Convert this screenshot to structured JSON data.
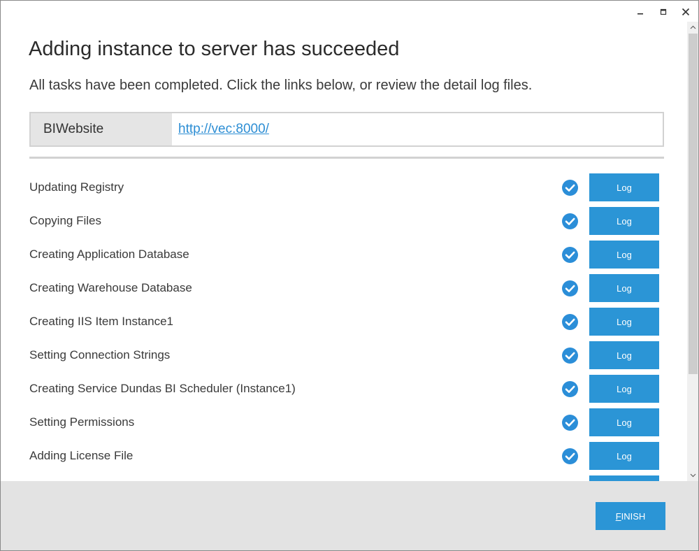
{
  "window": {
    "controls": {
      "minimize_icon": "minimize-icon",
      "maximize_icon": "maximize-icon",
      "close_icon": "close-icon"
    }
  },
  "header": {
    "title": "Adding instance to server has succeeded",
    "subtitle": "All tasks have been completed.  Click the links below, or review the detail log files."
  },
  "website": {
    "label": "BIWebsite",
    "url": "http://vec:8000/"
  },
  "tasks": [
    {
      "label": "Updating Registry",
      "status": "check-circle-icon",
      "button": "Log"
    },
    {
      "label": "Copying Files",
      "status": "check-circle-icon",
      "button": "Log"
    },
    {
      "label": "Creating Application Database",
      "status": "check-circle-icon",
      "button": "Log"
    },
    {
      "label": "Creating Warehouse Database",
      "status": "check-circle-icon",
      "button": "Log"
    },
    {
      "label": "Creating IIS Item Instance1",
      "status": "check-circle-icon",
      "button": "Log"
    },
    {
      "label": "Setting Connection Strings",
      "status": "check-circle-icon",
      "button": "Log"
    },
    {
      "label": "Creating Service Dundas BI Scheduler (Instance1)",
      "status": "check-circle-icon",
      "button": "Log"
    },
    {
      "label": "Setting Permissions",
      "status": "check-circle-icon",
      "button": "Log"
    },
    {
      "label": "Adding License File",
      "status": "check-circle-icon",
      "button": "Log"
    },
    {
      "label": "",
      "status": "",
      "button": ""
    }
  ],
  "footer": {
    "finish_mnemonic": "F",
    "finish_rest": "INISH"
  },
  "colors": {
    "accent": "#2b95d6",
    "check": "#2b8ed8",
    "link": "#2d8ed4",
    "footer_bg": "#e3e3e3"
  }
}
